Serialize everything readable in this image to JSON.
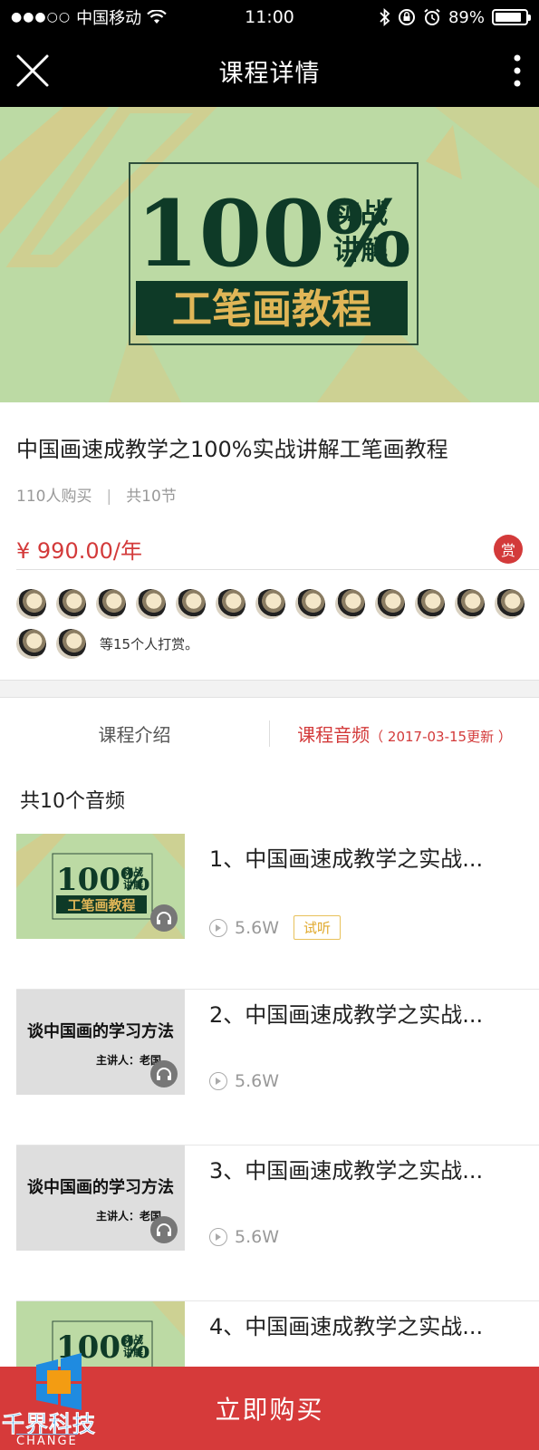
{
  "status_bar": {
    "carrier": "中国移动",
    "time": "11:00",
    "battery": "89%",
    "battery_level": 0.89
  },
  "nav": {
    "title": "课程详情"
  },
  "banner": {
    "big_text": "100%",
    "side_text_1": "实战",
    "side_text_2": "讲解",
    "box_text": "工笔画教程"
  },
  "course": {
    "title": "中国画速成教学之100%实战讲解工笔画教程",
    "buyers": "110人购买",
    "separator": "|",
    "lessons": "共10节",
    "price": "¥ 990.00/年",
    "reward_badge": "赏"
  },
  "rewards": {
    "text": "等15个人打赏。",
    "count": 15
  },
  "tabs": {
    "intro": "课程介绍",
    "audio": "课程音频",
    "audio_update": "（ 2017-03-15更新 ）"
  },
  "audio_list": {
    "count_title": "共10个音频",
    "items": [
      {
        "title": "1、中国画速成教学之实战...",
        "plays": "5.6W",
        "tag": "试听",
        "thumb": "green"
      },
      {
        "title": "2、中国画速成教学之实战...",
        "plays": "5.6W",
        "thumb": "grey"
      },
      {
        "title": "3、中国画速成教学之实战...",
        "plays": "5.6W",
        "thumb": "grey"
      },
      {
        "title": "4、中国画速成教学之实战...",
        "thumb": "green"
      }
    ],
    "thumb_grey_line1": "谈中国画的学习方法",
    "thumb_grey_line2": "主讲人：老国"
  },
  "footer": {
    "buy_label": "立即购买"
  },
  "watermark": {
    "text": "千界科技",
    "sub": "CHANGE"
  },
  "colors": {
    "accent": "#d33a3a",
    "banner_bg": "#bcdaa4",
    "dark_green": "#0e3a27",
    "gold": "#e0b657"
  }
}
